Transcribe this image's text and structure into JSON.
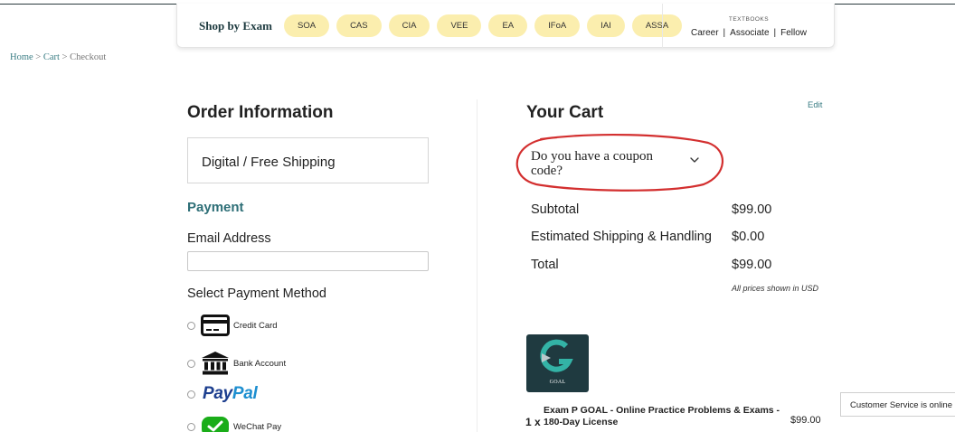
{
  "exam_nav": {
    "shop_by_label": "Shop by Exam",
    "exams": [
      "SOA",
      "CAS",
      "CIA",
      "VEE",
      "EA",
      "IFoA",
      "IAI",
      "ASSA"
    ],
    "textbooks_label": "TEXTBOOKS",
    "textbook_links": [
      "Career",
      "Associate",
      "Fellow"
    ],
    "textbook_separator": "|"
  },
  "breadcrumb": {
    "home": "Home",
    "cart": "Cart",
    "current": "Checkout",
    "separator": ">"
  },
  "order_info": {
    "title": "Order Information",
    "shipping_option": "Digital / Free Shipping",
    "payment_title": "Payment",
    "email_label": "Email Address",
    "email_value": "",
    "method_label": "Select Payment Method",
    "methods": {
      "credit_card": "Credit Card",
      "bank_account": "Bank Account",
      "paypal_part1": "Pay",
      "paypal_part2": "Pal",
      "wechat": "WeChat Pay"
    }
  },
  "cart": {
    "title": "Your Cart",
    "edit_label": "Edit",
    "coupon_label": "Do you have a coupon code?",
    "subtotal_label": "Subtotal",
    "subtotal_value": "$99.00",
    "shipping_label": "Estimated Shipping & Handling",
    "shipping_value": "$0.00",
    "total_label": "Total",
    "total_value": "$99.00",
    "currency_note": "All prices shown in USD",
    "item": {
      "image_text": "GOAL",
      "quantity": "1 x",
      "name": "Exam P GOAL - Online Practice Problems & Exams - 180-Day License",
      "price": "$99.00"
    }
  },
  "customer_service": {
    "label": "Customer Service is online"
  },
  "colors": {
    "accent_teal": "#2e6f77",
    "pill_yellow": "#fbeeae",
    "annotation_red": "#d32f2f",
    "product_tile": "#1f3a40"
  },
  "icons": [
    "credit-card-icon",
    "bank-icon",
    "wechat-icon",
    "chevron-down-icon",
    "goal-logo"
  ]
}
